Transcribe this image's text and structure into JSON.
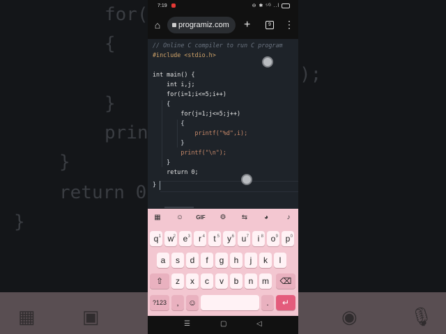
{
  "background": {
    "code_lines": [
      "for(",
      "{",
      "); ",
      "}",
      "prin",
      "}",
      "return 0",
      "}"
    ]
  },
  "status_bar": {
    "time": "7:19",
    "icons": "⊖ ✱ ⁵ᴳ ..l"
  },
  "browser": {
    "url": "programiz.com",
    "tab_count": "9"
  },
  "editor": {
    "lines": [
      {
        "code": "// Online C compiler to run C program"
      },
      {
        "code": "#include <stdio.h>"
      },
      {
        "code": ""
      },
      {
        "code": "int main() {"
      },
      {
        "code": "    int i,j;"
      },
      {
        "code": "    for(i=1;i<=5;i++)"
      },
      {
        "code": "    {"
      },
      {
        "code": "        for(j=1;j<=5;j++)"
      },
      {
        "code": "        {"
      },
      {
        "code": "            printf(\"%d\",i);"
      },
      {
        "code": "        }"
      },
      {
        "code": "        printf(\"\\n\");"
      },
      {
        "code": "    }"
      },
      {
        "code": "    return 0;"
      },
      {
        "code": "}"
      }
    ]
  },
  "keyboard": {
    "toolbar": [
      "GIF"
    ],
    "row1": [
      {
        "k": "q",
        "n": "1"
      },
      {
        "k": "w",
        "n": "2"
      },
      {
        "k": "e",
        "n": "3"
      },
      {
        "k": "r",
        "n": "4"
      },
      {
        "k": "t",
        "n": "5"
      },
      {
        "k": "y",
        "n": "6"
      },
      {
        "k": "u",
        "n": "7"
      },
      {
        "k": "i",
        "n": "8"
      },
      {
        "k": "o",
        "n": "9"
      },
      {
        "k": "p",
        "n": "0"
      }
    ],
    "row2": [
      "a",
      "s",
      "d",
      "f",
      "g",
      "h",
      "j",
      "k",
      "l"
    ],
    "row3": [
      "z",
      "x",
      "c",
      "v",
      "b",
      "n",
      "m"
    ],
    "symbols_label": "?123",
    "comma": ",",
    "period": "."
  },
  "colors": {
    "keyboard_bg": "#f3c7d1",
    "enter_key": "#e45c7c",
    "editor_bg": "#1e2329"
  }
}
